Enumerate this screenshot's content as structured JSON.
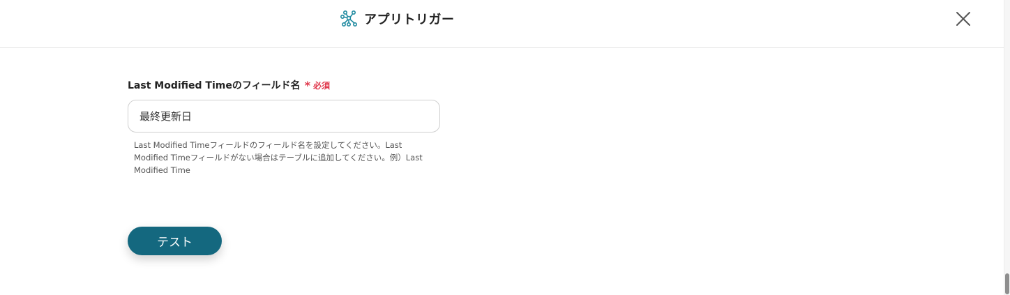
{
  "header": {
    "title": "アプリトリガー",
    "icon": "app-trigger-icon",
    "close_icon": "close-icon"
  },
  "form": {
    "field": {
      "label": "Last Modified Timeのフィールド名",
      "required_mark": "*",
      "required_text": "必須",
      "value": "最終更新日",
      "help_text": "Last Modified Timeフィールドのフィールド名を設定してください。Last Modified Timeフィールドがない場合はテーブルに追加してください。例）Last Modified Time"
    },
    "test_button_label": "テスト"
  },
  "colors": {
    "accent": "#14687f",
    "required": "#e0384c",
    "icon_teal": "#1f8aa0"
  }
}
